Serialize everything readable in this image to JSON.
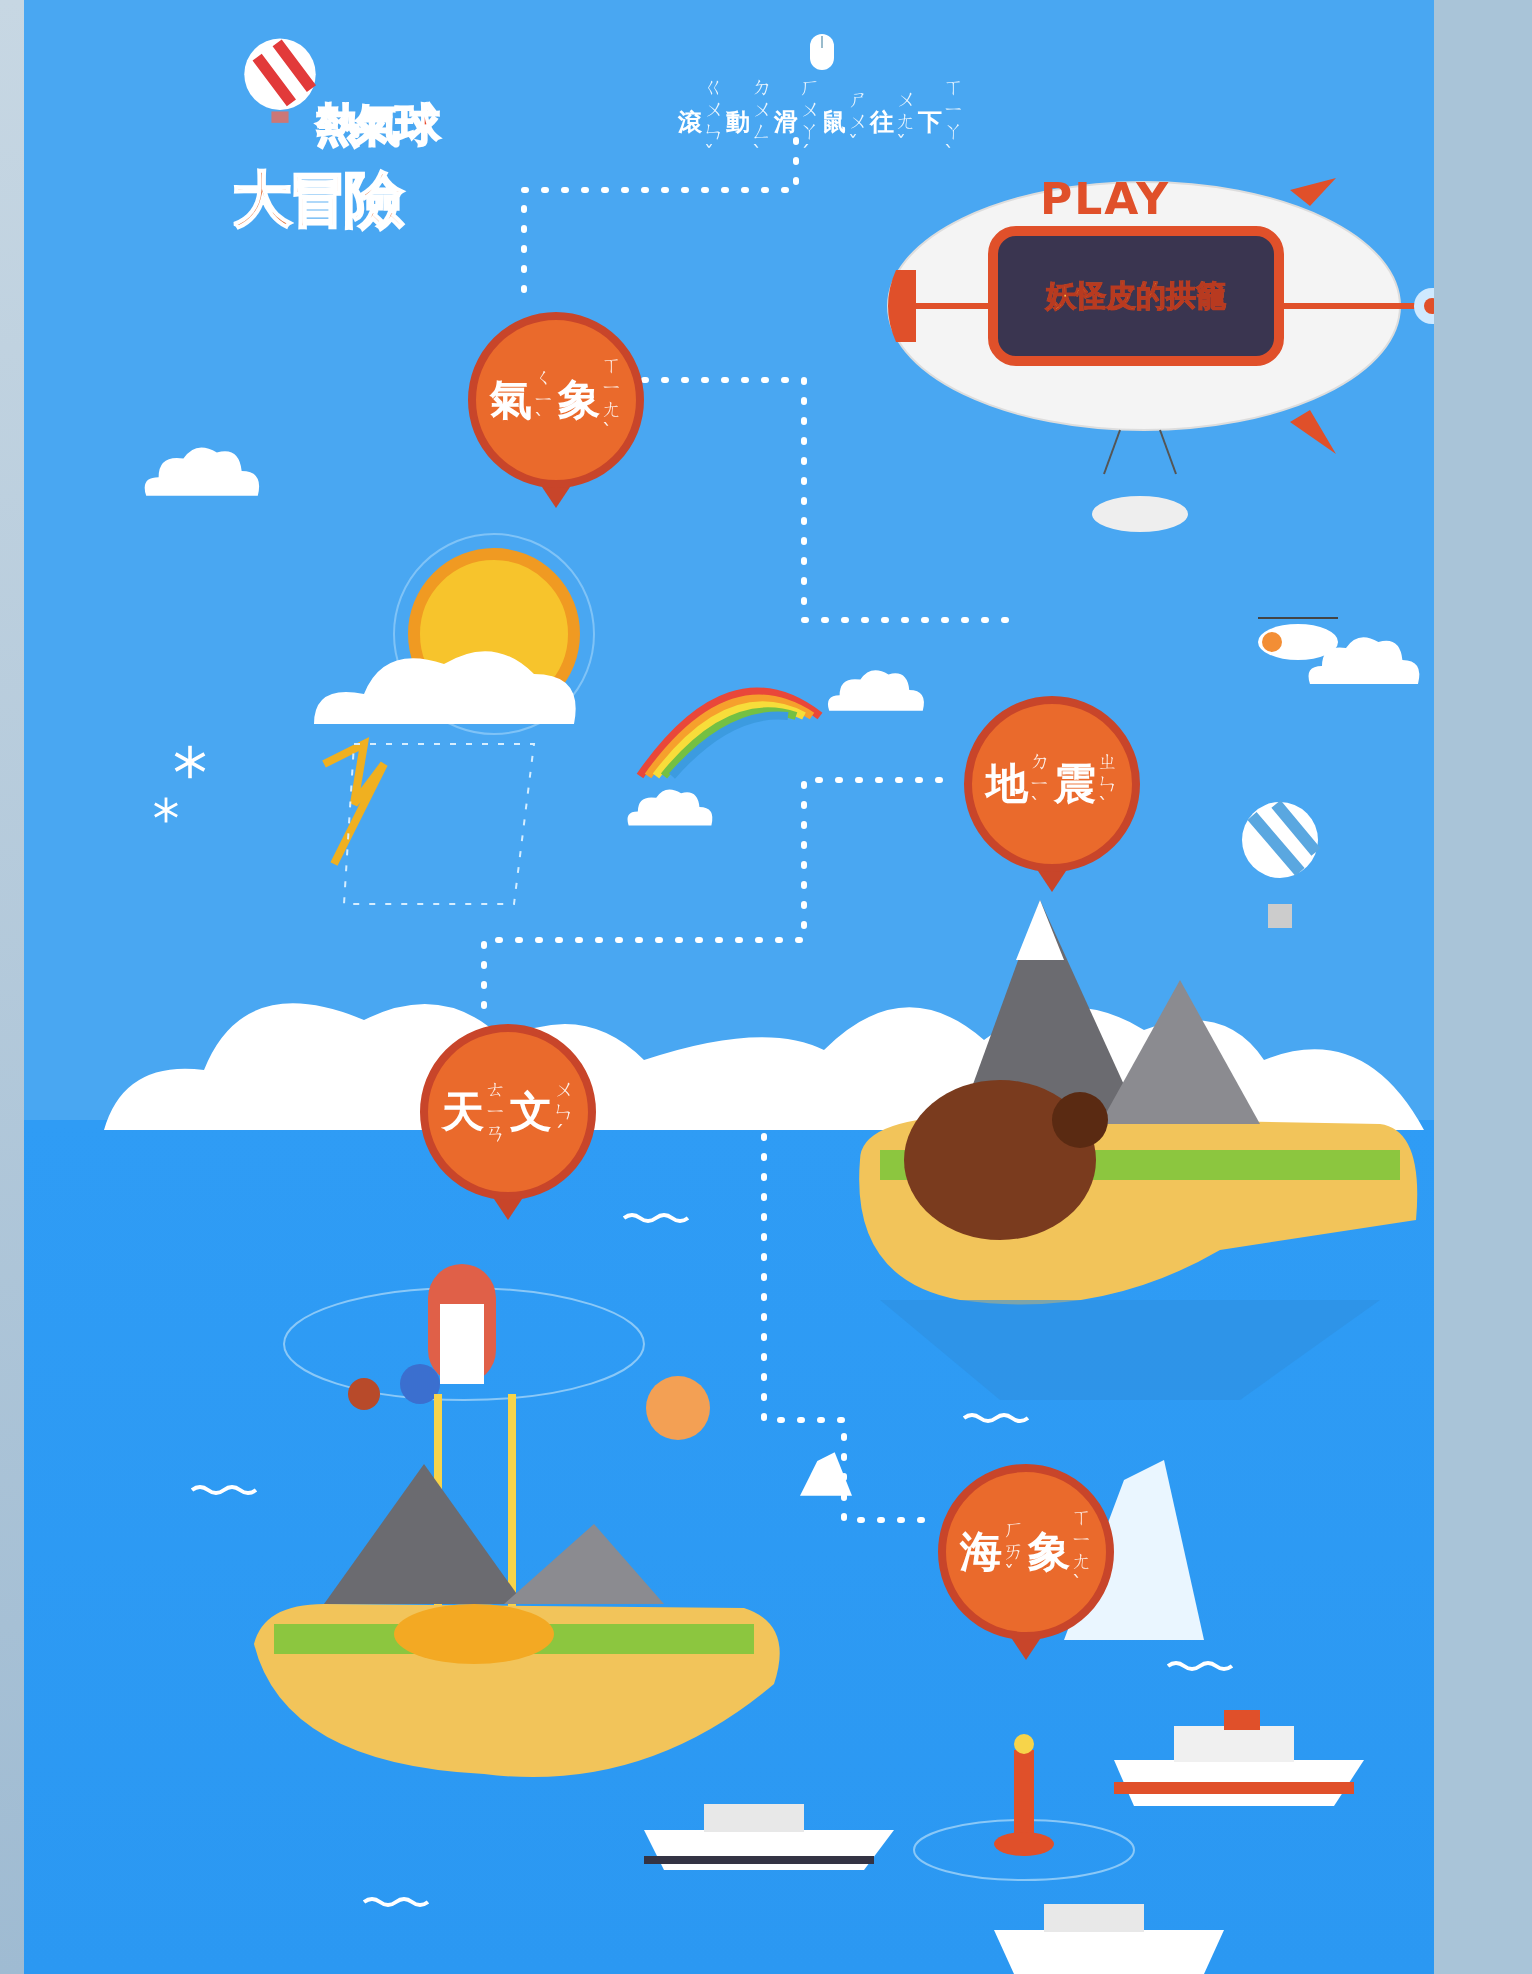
{
  "logo": {
    "line_1": "熱氣球",
    "line_2": "大冒險"
  },
  "scroll_hint": [
    {
      "char": "滾",
      "zhuyin": "ㄍㄨㄣˇ"
    },
    {
      "char": "動",
      "zhuyin": "ㄉㄨㄥˋ"
    },
    {
      "char": "滑",
      "zhuyin": "ㄏㄨㄚˊ"
    },
    {
      "char": "鼠",
      "zhuyin": "ㄕㄨˇ"
    },
    {
      "char": "往",
      "zhuyin": "ㄨㄤˇ"
    },
    {
      "char": "下",
      "zhuyin": "ㄒㄧㄚˋ"
    }
  ],
  "airship": {
    "label": "PLAY",
    "sign": "妖怪皮的拱籠"
  },
  "topics": [
    {
      "kind": "weather",
      "chars": [
        {
          "char": "氣",
          "zhuyin": "ㄑㄧˋ"
        },
        {
          "char": "象",
          "zhuyin": "ㄒㄧㄤˋ"
        }
      ]
    },
    {
      "kind": "earthquake",
      "chars": [
        {
          "char": "地",
          "zhuyin": "ㄉㄧˋ"
        },
        {
          "char": "震",
          "zhuyin": "ㄓㄣˋ"
        }
      ]
    },
    {
      "kind": "astronomy",
      "chars": [
        {
          "char": "天",
          "zhuyin": "ㄊㄧㄢ"
        },
        {
          "char": "文",
          "zhuyin": "ㄨㄣˊ"
        }
      ]
    },
    {
      "kind": "ocean",
      "chars": [
        {
          "char": "海",
          "zhuyin": "ㄏㄞˇ"
        },
        {
          "char": "象",
          "zhuyin": "ㄒㄧㄤˋ"
        }
      ]
    }
  ]
}
